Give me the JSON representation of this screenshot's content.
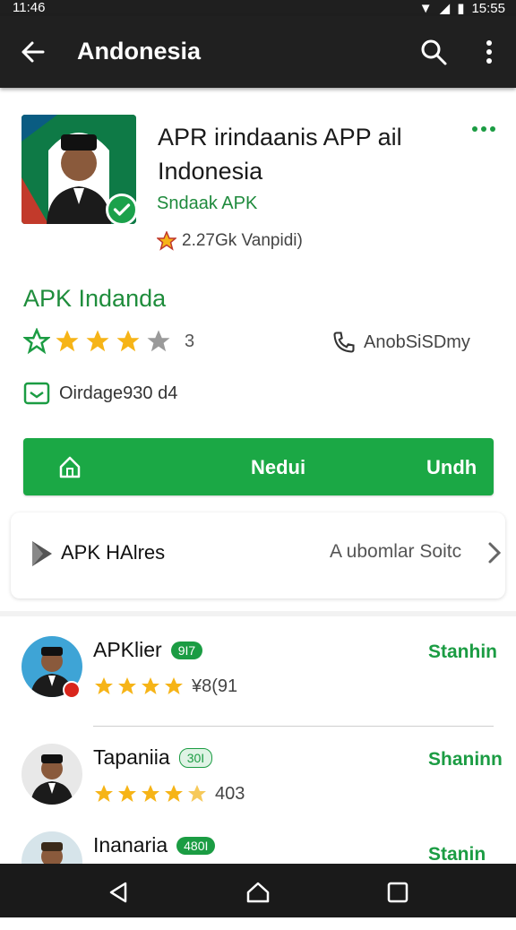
{
  "status_bar": {
    "time_left": "11:46",
    "time_right": "15:55"
  },
  "app_bar": {
    "title": "Andonesia"
  },
  "app": {
    "title": "APR irindaanis APP ail Indonesia",
    "developer": "Sndaak APK",
    "downloads": "2.27Gk Vanpidi)",
    "secondary_name": "APK Indanda",
    "rating": "3",
    "contact": "AnobSiSDmy",
    "size": "Oirdage930 d4"
  },
  "install_button": {
    "middle_label": "Nedui",
    "end_label": "Undh"
  },
  "info_card": {
    "left_label": "APK HAlres",
    "right_label": "A ubomlar Soitc"
  },
  "list": [
    {
      "name": "APKlier",
      "badge": "9I7",
      "count": "¥8(91",
      "status": "Stanhin"
    },
    {
      "name": "Tapaniia",
      "badge": "30I",
      "count": "403",
      "status": "Shaninn"
    },
    {
      "name": "Inanaria",
      "badge": "480I",
      "count": "",
      "status": "Stanin"
    }
  ],
  "colors": {
    "brand_green": "#1ba845",
    "text_green": "#1f8d3c",
    "star": "#f6b417"
  }
}
